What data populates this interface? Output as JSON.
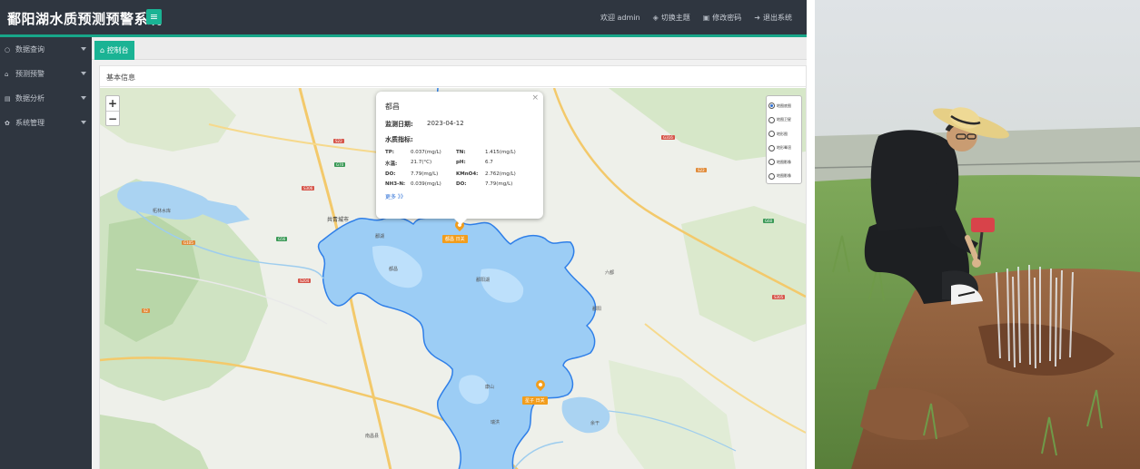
{
  "app": {
    "title": "鄱阳湖水质预测预警系统",
    "menu_toggle_icon": "hamburger-icon",
    "header_links": {
      "welcome": "欢迎 admin",
      "switch_theme": "切换主题",
      "change_password": "修改密码",
      "logout": "退出系统"
    },
    "sidebar": [
      {
        "icon": "circle-icon",
        "label": "数据查询"
      },
      {
        "icon": "home-icon",
        "label": "预测预警"
      },
      {
        "icon": "chart-icon",
        "label": "数据分析"
      },
      {
        "icon": "gear-icon",
        "label": "系统管理"
      }
    ],
    "active_tab": "控制台",
    "panel_title": "基本信息",
    "map": {
      "zoom_in": "+",
      "zoom_out": "−",
      "layers": [
        {
          "label": "地图底图",
          "selected": true
        },
        {
          "label": "地图卫星",
          "selected": false
        },
        {
          "label": "地形图",
          "selected": false
        },
        {
          "label": "地形晕渲",
          "selected": false
        },
        {
          "label": "地图影像",
          "selected": false
        },
        {
          "label": "地图影像",
          "selected": false
        }
      ],
      "markers": [
        {
          "label": "都昌 日关"
        },
        {
          "label": "星子 日关"
        }
      ],
      "place_names": {
        "city": "共青城市",
        "lake_west": "柘林水库",
        "p1": "鄱湖",
        "p2": "都昌",
        "p3": "鄱阳湖",
        "p4": "六都",
        "p5": "鄱阳",
        "p6": "余干",
        "p7": "康山",
        "p8": "瑞洪",
        "p9": "南昌县",
        "p10": "湖口"
      },
      "road_shields": [
        "S22",
        "G70",
        "S306",
        "G105",
        "S204",
        "G56",
        "S2",
        "G316",
        "S22",
        "G60",
        "S305"
      ]
    },
    "popup": {
      "close": "×",
      "station": "都昌",
      "date_label": "监测日期:",
      "date_value": "2023-04-12",
      "indicators_label": "水质指标:",
      "rows": [
        [
          "TP:",
          "0.037(mg/L)",
          "TN:",
          "1.415(mg/L)"
        ],
        [
          "水温:",
          "21.7(°C)",
          "pH:",
          "6.7"
        ],
        [
          "DO:",
          "7.79(mg/L)",
          "KMnO4:",
          "2.762(mg/L)"
        ],
        [
          "NH3-N:",
          "0.039(mg/L)",
          "DO:",
          "7.79(mg/L)"
        ]
      ],
      "more": "更多 》》"
    }
  },
  "colors": {
    "header_bg": "#2f3640",
    "accent_green": "#1ab394",
    "lake_fill": "#9ccdf5",
    "lake_border": "#2f7fe8",
    "marker_orange": "#f29d1c"
  }
}
